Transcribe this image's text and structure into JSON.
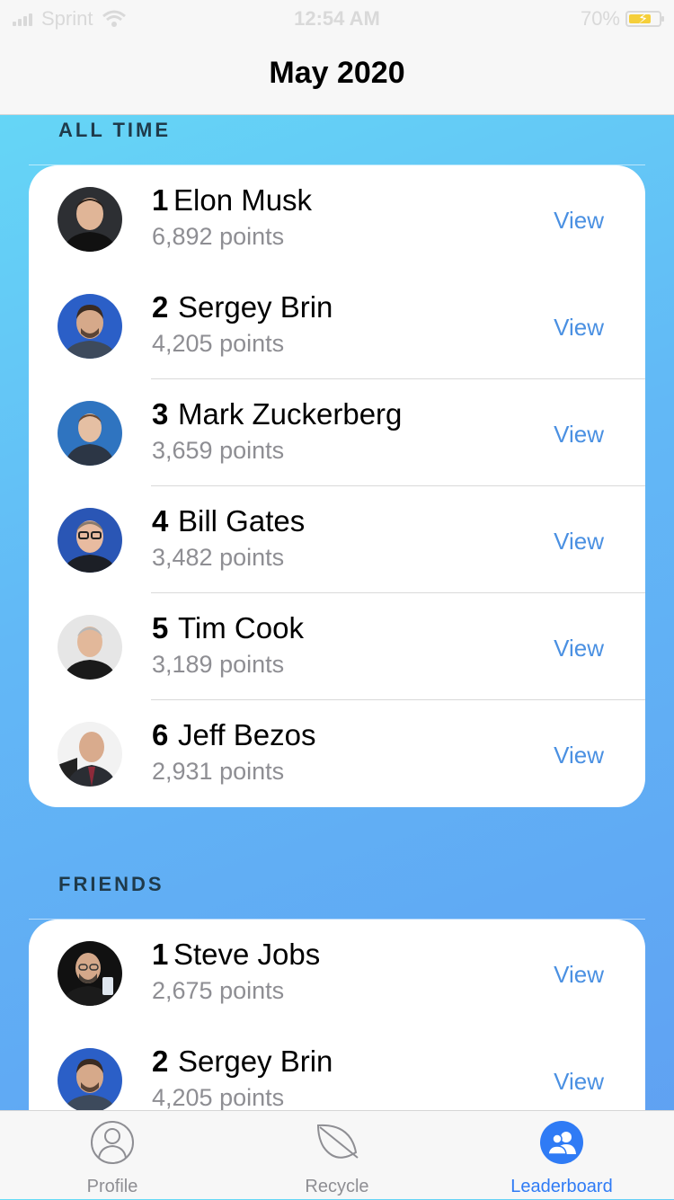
{
  "status_bar": {
    "carrier": "Sprint",
    "time": "12:54 AM",
    "battery": "70%"
  },
  "nav": {
    "title": "May 2020"
  },
  "sections": [
    {
      "header": "ALL TIME",
      "entries": [
        {
          "rank": "1",
          "name": "Elon Musk",
          "points": "6,892 points",
          "action": "View"
        },
        {
          "rank": "2",
          "name": "Sergey Brin",
          "points": "4,205 points",
          "action": "View"
        },
        {
          "rank": "3",
          "name": "Mark Zuckerberg",
          "points": "3,659 points",
          "action": "View"
        },
        {
          "rank": "4",
          "name": "Bill Gates",
          "points": "3,482 points",
          "action": "View"
        },
        {
          "rank": "5",
          "name": "Tim Cook",
          "points": "3,189 points",
          "action": "View"
        },
        {
          "rank": "6",
          "name": "Jeff Bezos",
          "points": "2,931 points",
          "action": "View"
        }
      ]
    },
    {
      "header": "FRIENDS",
      "entries": [
        {
          "rank": "1",
          "name": "Steve Jobs",
          "points": "2,675 points",
          "action": "View"
        },
        {
          "rank": "2",
          "name": "Sergey Brin",
          "points": "4,205 points",
          "action": "View"
        }
      ]
    }
  ],
  "tabs": [
    {
      "label": "Profile",
      "icon": "person-circle-icon",
      "active": false
    },
    {
      "label": "Recycle",
      "icon": "leaf-icon",
      "active": false
    },
    {
      "label": "Leaderboard",
      "icon": "group-icon",
      "active": true
    }
  ],
  "colors": {
    "accent": "#4a90e2",
    "tab_active": "#2f7bf5",
    "gradient_start": "#66dcf6",
    "gradient_end": "#5f9ff2"
  }
}
